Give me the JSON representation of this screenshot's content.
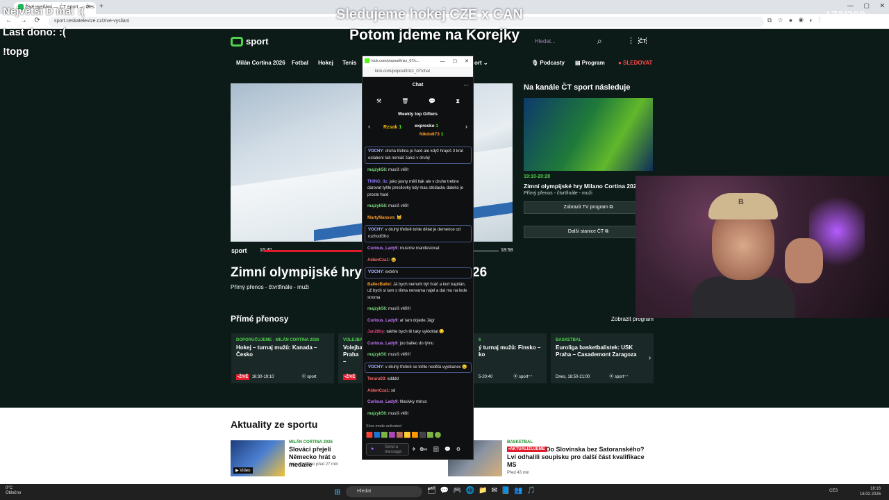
{
  "browser": {
    "tab_title": "Živé vysílání — ČT sport — Čes",
    "url": "sport.ceskatelevize.cz/zive-vysilani",
    "nav": "← → ⟳",
    "window_controls": "—  ▢  ✕",
    "extensions": "⧉ ☆ ● ◉ ◐ ⋮"
  },
  "overlay": {
    "left_line1": "Největší D má: :(",
    "left_line2": "Last dono: :(",
    "left_line3": "!topg",
    "center_line1": "Sledujeme hokej CZE x CAN",
    "center_line2": "Potom jdeme na Korejky",
    "counter": "173/200"
  },
  "site": {
    "logo": "sport",
    "search_placeholder": "Hledat...",
    "ct_label": "ČT",
    "nav": [
      "Milán Cortina 2026",
      "Fotbal",
      "Hokej",
      "Tenis"
    ],
    "nav_more": "ort ⌄",
    "nav_right": [
      "🎙 Podcasty",
      "▤ Program"
    ],
    "follow": "● SLEDOVAT",
    "hero": {
      "time_start": "16:40",
      "time_end": "18:58",
      "title_left": "Zimní olympijské hry",
      "title_right": "26",
      "subtitle": "Přímý přenos - čtvrtfinále - muži",
      "progress": 0.44
    },
    "side": {
      "title": "Na kanále ČT sport následuje",
      "time": "19:10-20:28",
      "event": "Zimní olympijské hry Milano Cortina 2026",
      "sub": "Přímý přenos - čtvrtfinále - muži",
      "btn1": "Zobrazit TV program ⧉",
      "btn2": "Další stanice ČT ⧉"
    },
    "live": {
      "title": "Přímé přenosy",
      "all": "Zobrazit program",
      "cards": [
        {
          "tag": "DOPORUČUJEME · MILÁN CORTINA 2026",
          "title": "Hokej – turnaj mužů: Kanada – Česko",
          "live": "•ŽIVĚ",
          "time": "16:30-19:10",
          "logo": "⦿ sport"
        },
        {
          "tag": "VOLEJBA",
          "title": "Volejba Praha –",
          "live": "•ŽIVĚ",
          "time": "",
          "logo": ""
        },
        {
          "tag": "6",
          "title": "ý turnaj mužů: Finsko – ko",
          "live": "",
          "time": "5-20:40",
          "logo": "⦿ sport⁺⁺"
        },
        {
          "tag": "BASKETBAL",
          "title": "Euroliga basketbalistek: USK Praha – Casademont Zaragoza",
          "live": "",
          "time": "Dnes, 18:50-21:00",
          "logo": "⦿ sport⁺⁺"
        }
      ]
    },
    "news": {
      "title": "Aktuality ze sportu",
      "item1": {
        "tag": "MILÁN CORTINA 2026",
        "text": "Slováci přejeli Německo hrát o medaile",
        "time": "Aktualizováno před 27 min",
        "badge": "▶ Video"
      },
      "item2": {
        "tag": "BASKETBAL",
        "badge": "•AKTUALIZUJEME",
        "text": "Do Slovinska bez Satoranského? Lví odhalili soupisku pro další část kvalifikace MS",
        "time": "Před 43 min"
      }
    }
  },
  "chat": {
    "window_title": "kick.com/popout/trizz_07/c...",
    "url": "kick.com/popout/trizz_07/chat",
    "window_controls": "—  ▢  ✕",
    "label": "Chat",
    "menu": "⋯",
    "tools": [
      "⚒",
      "🗑",
      "💬",
      "⧗"
    ],
    "gifters_title": "Weekly top Gifters",
    "gifters": [
      {
        "name": "Rzsak",
        "count": "1"
      },
      {
        "name": "expresko",
        "count": "1"
      },
      {
        "name": "Nikdo673",
        "count": "1"
      }
    ],
    "arrow_left": "‹",
    "arrow_right": "›",
    "messages": [
      {
        "user": "VOCHY",
        "color": "#a7b6ff",
        "text": ": druhá třetina je hard ale když hraješ 3 krát oslabení tak nemáš šanci v druhý",
        "hl": true
      },
      {
        "user": "majzyk56",
        "color": "#77dd77",
        "text": ": musíš věřit",
        "hl": false
      },
      {
        "user": "THING_liz",
        "color": "#8f7bff",
        "text": ": jako jasny měli tlak ale v druhe tretine darovat tyhle presilovky kdy mas stridacku daleko je proste hard",
        "hl": false
      },
      {
        "user": "majzyk56",
        "color": "#77dd77",
        "text": ": musíš věřit",
        "hl": false
      },
      {
        "user": "MartyManson",
        "color": "#ff9d2e",
        "text": ": 🐱",
        "hl": false
      },
      {
        "user": "VOCHY",
        "color": "#a7b6ff",
        "text": ": v druhý třetině tohle dělat je demence od rozhodčího",
        "hl": true
      },
      {
        "user": "Curious_Lady9",
        "color": "#c77dff",
        "text": ": musíme manifestovat",
        "hl": false
      },
      {
        "user": "AidenCza1",
        "color": "#ff6b6b",
        "text": ": 😀",
        "hl": false
      },
      {
        "user": "VOCHY",
        "color": "#a7b6ff",
        "text": ": extrém",
        "hl": true
      },
      {
        "user": "BallecBallei",
        "color": "#ff9d2e",
        "text": ": Já bych nemohl být hráč a kort kapitán, už bych si tam s těma nervama najel a dal mu na lede stroma",
        "hl": false
      },
      {
        "user": "majzyk56",
        "color": "#77dd77",
        "text": ": musíš věřit!!",
        "hl": false
      },
      {
        "user": "Curious_Lady9",
        "color": "#c77dff",
        "text": ": ať tam dojede Jágr",
        "hl": false
      },
      {
        "user": "Jan28by",
        "color": "#e0457b",
        "text": ": takhle bych tě taky vykloktal 😏",
        "hl": false
      },
      {
        "user": "Curious_Lady9",
        "color": "#c77dff",
        "text": ": joo balleo do týmu",
        "hl": false
      },
      {
        "user": "majzyk56",
        "color": "#77dd77",
        "text": ": musíš věřit!!",
        "hl": false
      },
      {
        "user": "VOCHY",
        "color": "#a7b6ff",
        "text": ": v druhý třetině se tohle nedělá vyjebanec 😠",
        "hl": true
      },
      {
        "user": "Teruru03",
        "color": "#ff6b6b",
        "text": ": xdddd",
        "hl": false
      },
      {
        "user": "AidenCza1",
        "color": "#ff6b6b",
        "text": ": xd",
        "hl": false
      },
      {
        "user": "Curious_Lady9",
        "color": "#c77dff",
        "text": ": hlasivky minus",
        "hl": false
      },
      {
        "user": "majzyk56",
        "color": "#77dd77",
        "text": ": musíš věřit",
        "hl": false
      }
    ],
    "slow_mode": "Slow mode activated",
    "emotes": "🟥🟦🟩🟪🟫🟨🟧⬛🟩🟢",
    "input_placeholder": "Send a message",
    "send": "✈ ☺",
    "actions": "⚙∞ 🗄 💬 ⚙"
  },
  "webcam": {
    "cap_letter": "B"
  },
  "taskbar": {
    "weather_temp": "0°C",
    "weather_desc": "Oblačno",
    "start": "⊞",
    "search": "Hledat",
    "icons": "🗂💬🎮🌐📁✉📘👥🎵",
    "lang": "CES",
    "time": "18:16",
    "date": "18.02.2026"
  }
}
